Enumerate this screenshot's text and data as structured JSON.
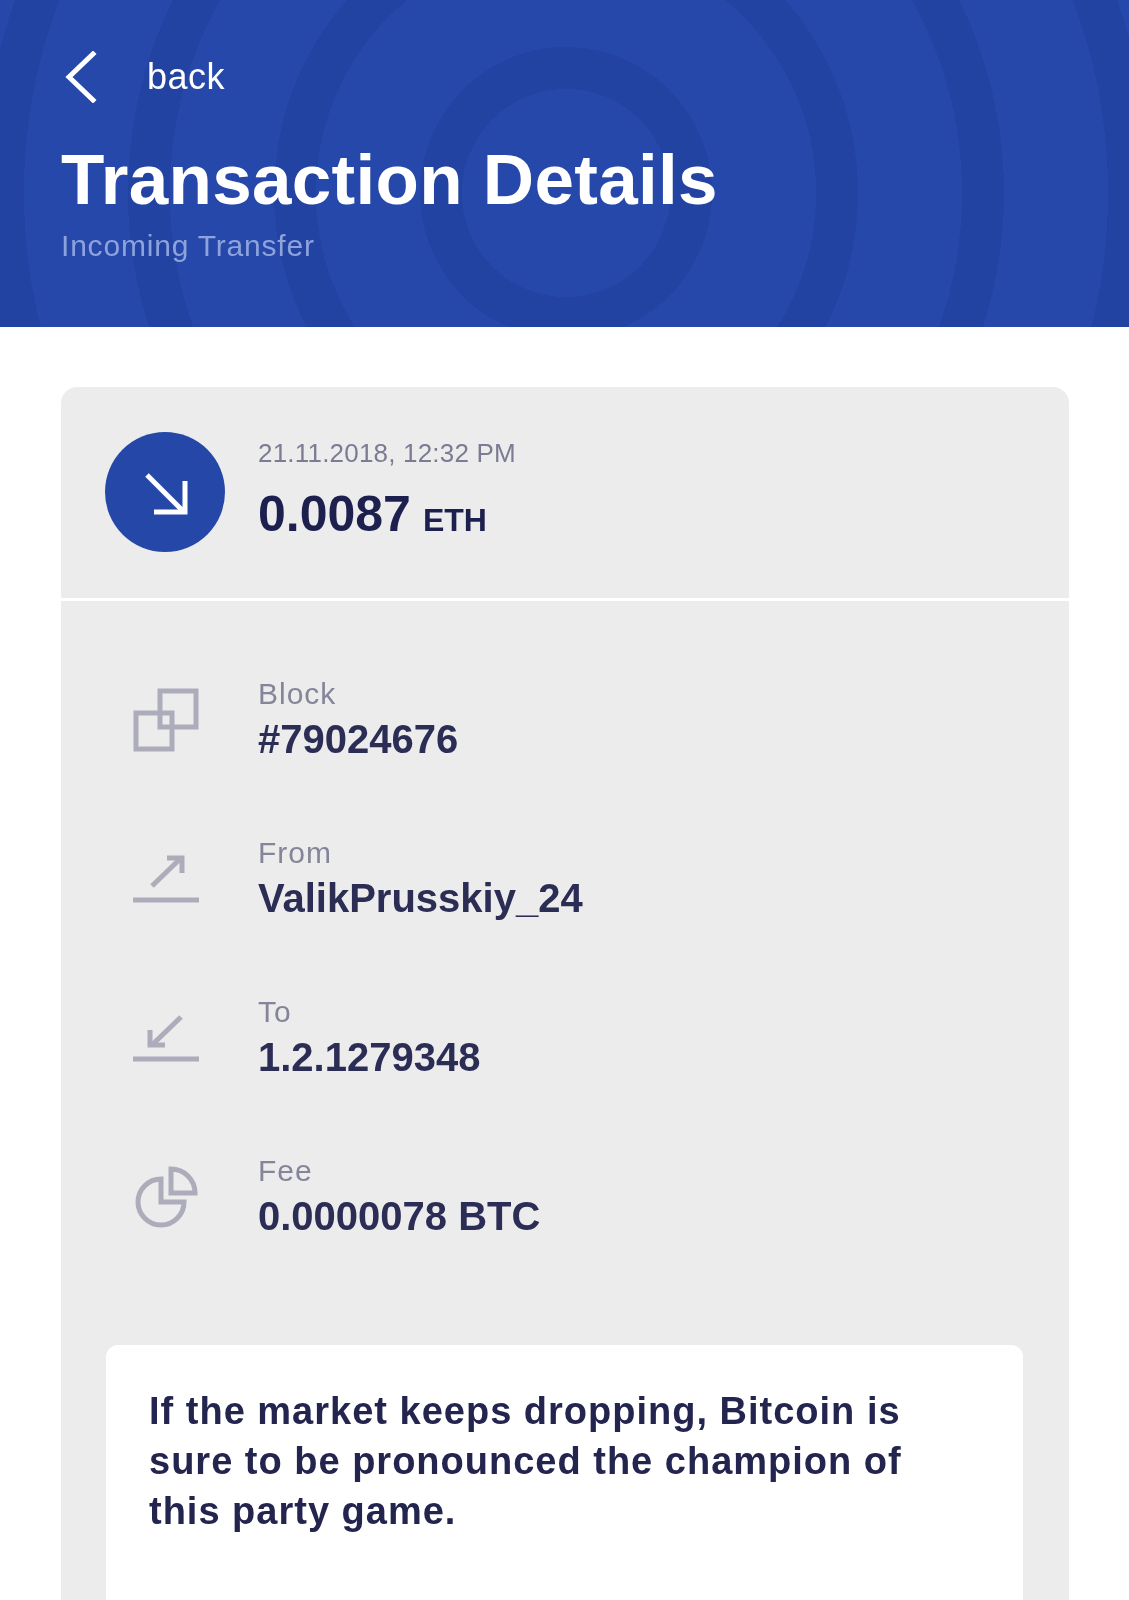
{
  "header": {
    "back_label": "back",
    "title": "Transaction Details",
    "subtitle": "Incoming Transfer"
  },
  "transaction": {
    "kind": "incoming",
    "date": "21.11.2018, 12:32 PM",
    "amount": "0.0087",
    "currency": "ETH"
  },
  "details": [
    {
      "kind": "block",
      "label": "Block",
      "value": "#79024676"
    },
    {
      "kind": "from",
      "label": "From",
      "value": "ValikPrusskiy_24"
    },
    {
      "kind": "to",
      "label": "To",
      "value": "1.2.1279348"
    },
    {
      "kind": "fee",
      "label": "Fee",
      "value": "0.0000078 BTC"
    }
  ],
  "note": {
    "text": "If the market keeps dropping, Bitcoin is sure to be pronounced the champion of this party game."
  }
}
